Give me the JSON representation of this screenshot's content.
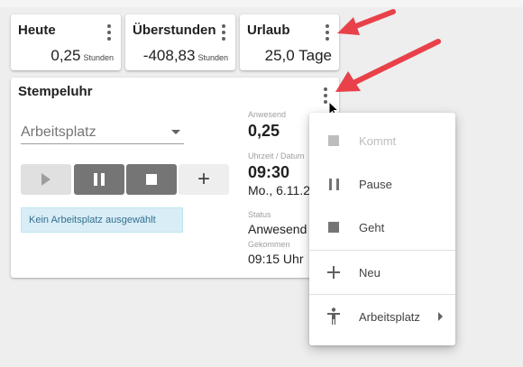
{
  "kpis": {
    "heute": {
      "title": "Heute",
      "value": "0,25",
      "unit": "Stunden"
    },
    "ueberstunden": {
      "title": "Überstunden",
      "value": "-408,83",
      "unit": "Stunden"
    },
    "urlaub": {
      "title": "Urlaub",
      "value": "25,0 Tage"
    }
  },
  "stempeluhr": {
    "title": "Stempeluhr",
    "workplace_placeholder": "Arbeitsplatz",
    "notice": "Kein Arbeitsplatz ausgewählt",
    "anwesend_label": "Anwesend",
    "anwesend_value": "0,25",
    "time_label": "Uhrzeit / Datum",
    "time_value": "09:30",
    "date_value": "Mo., 6.11.2",
    "status_label": "Status",
    "status_value": "Anwesend",
    "gekommen_label": "Gekommen",
    "gekommen_value": "09:15 Uhr",
    "add_symbol": "+"
  },
  "menu": {
    "items": [
      {
        "label": "Kommt",
        "icon": "stop-square-icon",
        "disabled": true
      },
      {
        "label": "Pause",
        "icon": "pause-icon",
        "disabled": false
      },
      {
        "label": "Geht",
        "icon": "stop-square-icon",
        "disabled": false
      },
      {
        "label": "Neu",
        "icon": "plus-icon",
        "disabled": false
      },
      {
        "label": "Arbeitsplatz",
        "icon": "person-icon",
        "disabled": false,
        "has_submenu": true
      }
    ]
  },
  "colors": {
    "annotation_arrow": "#e8414a",
    "notice_bg": "#d9edf7",
    "notice_text": "#31708f",
    "button_dark": "#757575"
  }
}
